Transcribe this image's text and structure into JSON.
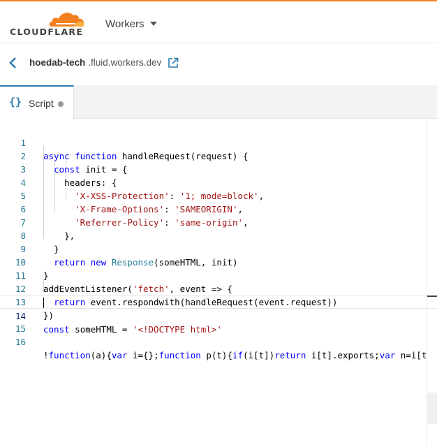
{
  "header": {
    "logo_text": "CLOUDFLARE",
    "product_menu_label": "Workers",
    "brand_color": "#f38020"
  },
  "worker": {
    "name": "hoedab-tech",
    "domain": ".fluid.workers.dev",
    "back_icon": "chevron-left-icon",
    "external_icon": "external-link-icon"
  },
  "tabs": [
    {
      "icon_text": "{}",
      "label": "Script",
      "modified": true
    }
  ],
  "editor": {
    "current_line": 14,
    "lines": [
      {
        "n": "1",
        "text": "async function handleRequest(request) {"
      },
      {
        "n": "2",
        "text": "  const init = {"
      },
      {
        "n": "3",
        "text": "    headers: {"
      },
      {
        "n": "4",
        "text": "      'X-XSS-Protection': '1; mode=block',"
      },
      {
        "n": "5",
        "text": "      'X-Frame-Options': 'SAMEORIGIN',"
      },
      {
        "n": "6",
        "text": "      'Referrer-Policy': 'same-origin',"
      },
      {
        "n": "7",
        "text": "    },"
      },
      {
        "n": "8",
        "text": "  }"
      },
      {
        "n": "9",
        "text": "  return new Response(someHTML, init)"
      },
      {
        "n": "10",
        "text": "}"
      },
      {
        "n": "11",
        "text": "addEventListener('fetch', event => {"
      },
      {
        "n": "12",
        "text": "  return event.respondwith(handleRequest(event.request))"
      },
      {
        "n": "13",
        "text": "})"
      },
      {
        "n": "14",
        "text": "const someHTML = '<!DOCTYPE html>'"
      },
      {
        "n": "15",
        "text": ""
      },
      {
        "n": "16",
        "text": "!function(a){var i={};function p(t){if(i[t])return i[t].exports;var n=i[t"
      }
    ]
  }
}
